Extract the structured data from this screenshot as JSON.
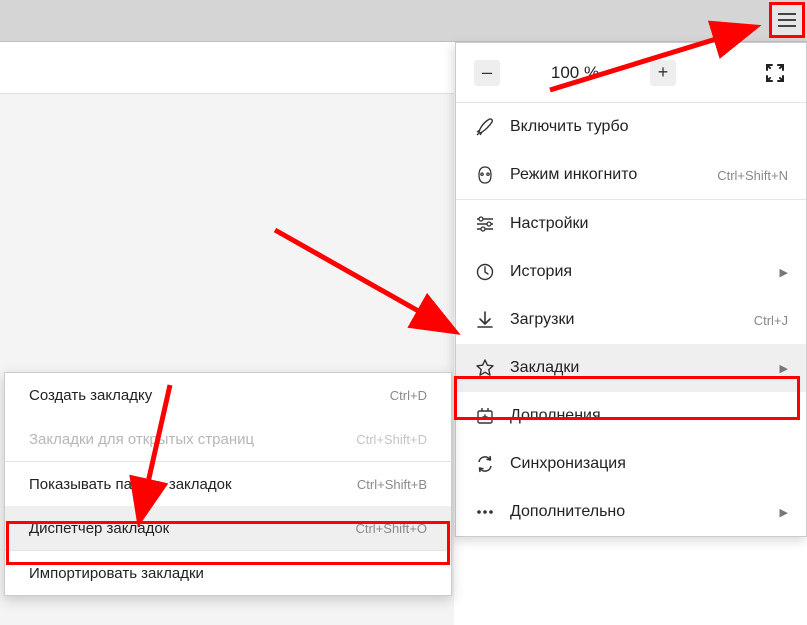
{
  "toolbar": {
    "hamburger_name": "menu"
  },
  "zoom": {
    "minus": "–",
    "level": "100 %",
    "plus": "+"
  },
  "menu": {
    "turbo": "Включить турбо",
    "incognito": {
      "label": "Режим инкогнито",
      "shortcut": "Ctrl+Shift+N"
    },
    "settings": "Настройки",
    "history": "История",
    "downloads": {
      "label": "Загрузки",
      "shortcut": "Ctrl+J"
    },
    "bookmarks": "Закладки",
    "addons": "Дополнения",
    "sync": "Синхронизация",
    "more": "Дополнительно"
  },
  "submenu": {
    "create": {
      "label": "Создать закладку",
      "shortcut": "Ctrl+D"
    },
    "open_tabs": {
      "label": "Закладки для открытых страниц",
      "shortcut": "Ctrl+Shift+D"
    },
    "show_bar": {
      "label": "Показывать панель закладок",
      "shortcut": "Ctrl+Shift+B"
    },
    "manager": {
      "label": "Диспетчер закладок",
      "shortcut": "Ctrl+Shift+O"
    },
    "import": {
      "label": "Импортировать закладки"
    }
  }
}
